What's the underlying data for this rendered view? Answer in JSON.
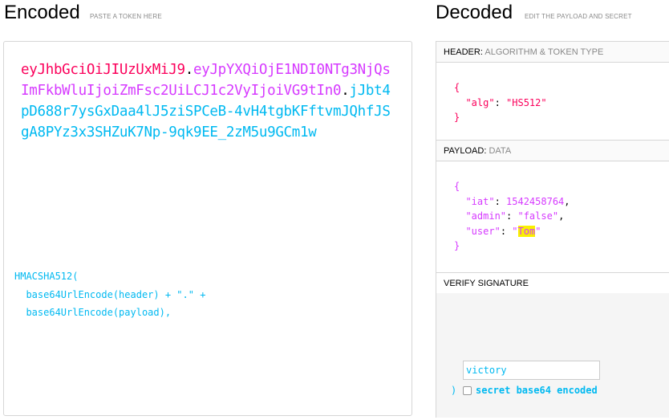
{
  "encoded": {
    "title": "Encoded",
    "subtitle": "PASTE A TOKEN HERE",
    "token": {
      "header_lines": [
        "eyJhbGciOiJIUzUxMiJ9"
      ],
      "dot1": ".",
      "payload_part": "eyJpYXQiOjE1NDI0NTg3NjQsImFkbWluIjoiZmFsc2UiLCJ1c2VyIjoiVG9tIn0",
      "dot2": ".",
      "signature_part": "jJbt4pD688r7ysGxDaa4lJ5ziSPCeB-4vH4tgbKFftvmJQhfJSgA8PYz3x3SHZuK7Np-9qk9EE_2zM5u9GCm1w"
    }
  },
  "decoded": {
    "title": "Decoded",
    "subtitle": "EDIT THE PAYLOAD AND SECRET",
    "header_section": {
      "label": "HEADER:",
      "label_muted": "ALGORITHM & TOKEN TYPE",
      "open_brace": "{",
      "key": "\"alg\"",
      "colon": ": ",
      "value": "\"HS512\"",
      "close_brace": "}"
    },
    "payload_section": {
      "label": "PAYLOAD:",
      "label_muted": "DATA",
      "open_brace": "{",
      "iat_key": "\"iat\"",
      "iat_value": "1542458764",
      "admin_key": "\"admin\"",
      "admin_value": "\"false\"",
      "user_key": "\"user\"",
      "user_quote_open": "\"",
      "user_value": "Tom",
      "user_quote_close": "\"",
      "close_brace": "}"
    },
    "verify_section": {
      "label": "VERIFY SIGNATURE",
      "line1": "HMACSHA512(",
      "line2": "  base64UrlEncode(header) + \".\" +",
      "line3": "  base64UrlEncode(payload),",
      "secret_value": "victory",
      "close": ")",
      "checkbox_label": "secret base64 encoded",
      "checkbox_checked": false
    }
  },
  "colors": {
    "header": "#fb015b",
    "payload": "#d63aff",
    "signature": "#00b9f1",
    "highlight": "#f9f000"
  }
}
